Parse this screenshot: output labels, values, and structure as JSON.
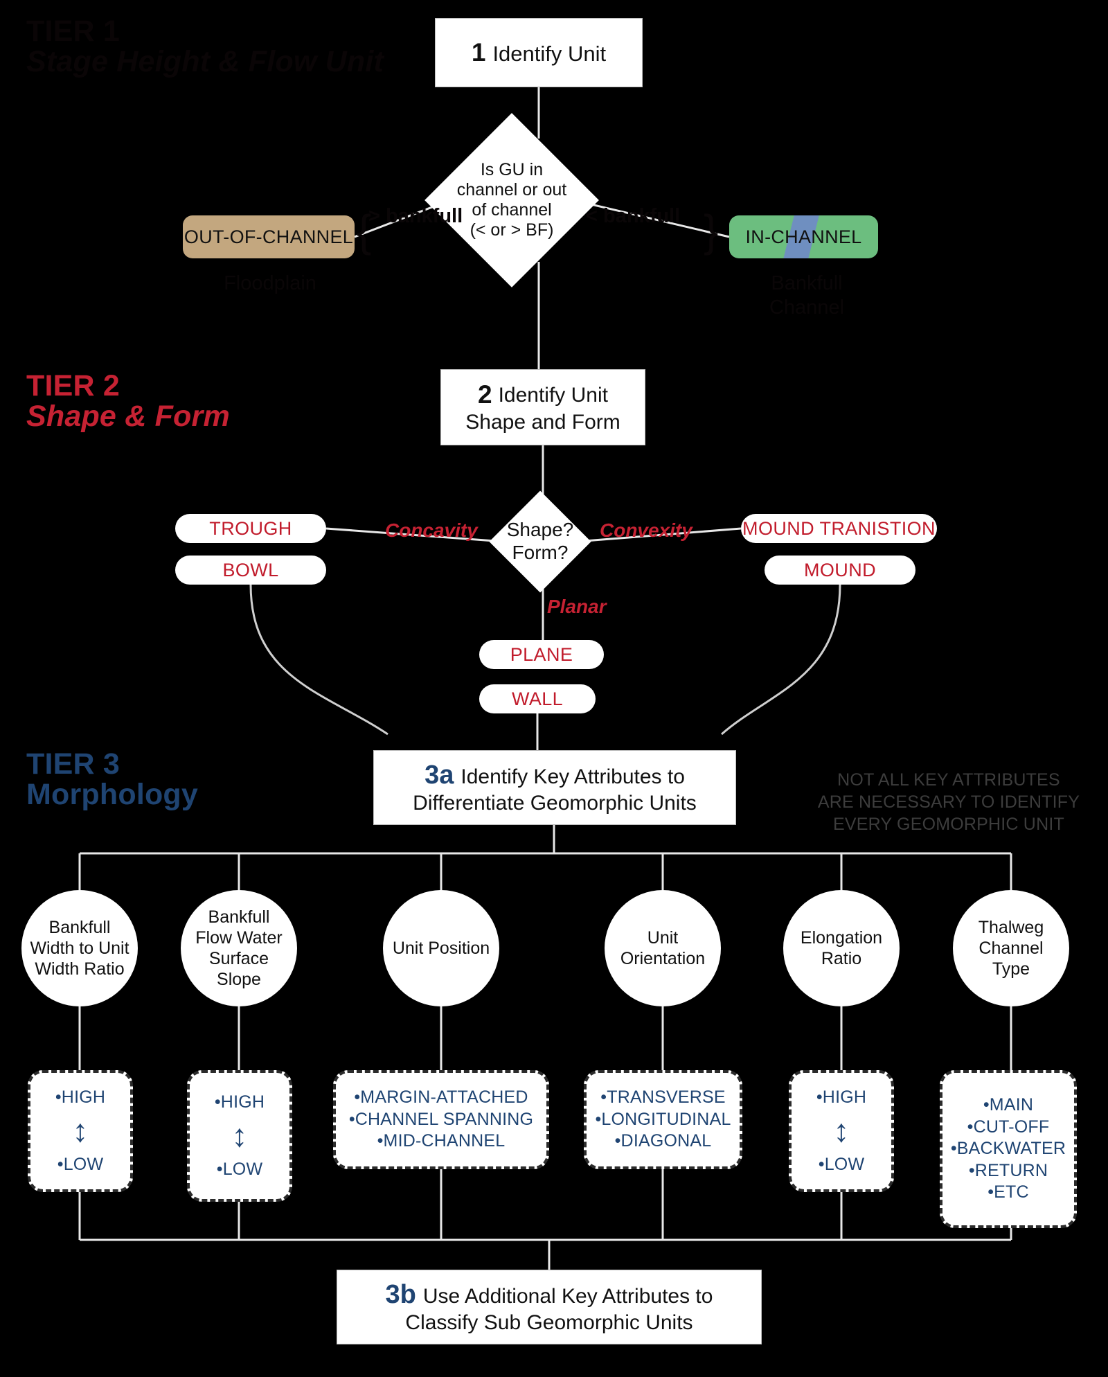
{
  "colors": {
    "red": "#c62233",
    "blue": "#1f4472",
    "tan": "#c3a77f",
    "green": "#6cbe7f",
    "water": "#6f8fc0",
    "gray_note": "#3d3d3d",
    "background": "#000000"
  },
  "tiers": [
    {
      "name": "tier-1",
      "line1": "TIER 1",
      "line2": "Stage Height & Flow Unit"
    },
    {
      "name": "tier-2",
      "line1": "TIER 2",
      "line2": "Shape & Form"
    },
    {
      "name": "tier-3",
      "line1": "TIER 3",
      "line2": "Morphology"
    }
  ],
  "steps": {
    "step1": {
      "num": "1",
      "text": "Identify Unit"
    },
    "step2": {
      "num": "2",
      "text_line1": "Identify Unit",
      "text_line2": "Shape and Form"
    },
    "step3a": {
      "num": "3a",
      "text_line1": "Identify Key Attributes to",
      "text_line2": "Differentiate Geomorphic Units"
    },
    "step3b": {
      "num": "3b",
      "text_line1": "Use Additional Key Attributes to",
      "text_line2": "Classify Sub Geomorphic Units"
    }
  },
  "decisions": {
    "channel": {
      "line1": "Is GU in",
      "line2": "channel or out",
      "line3": "of channel",
      "line4": "(< or > BF)"
    },
    "shape": {
      "line1": "Shape?",
      "line2": "Form?"
    }
  },
  "tier1_branches": {
    "left_condition": "> bankfull",
    "right_condition": "< bankfull",
    "left_chip": "OUT-OF-CHANNEL",
    "right_chip": "IN-CHANNEL",
    "left_caption": "Floodplain",
    "right_caption_line1": "Bankfull",
    "right_caption_line2": "Channel"
  },
  "tier2_words": {
    "concavity": "Concavity",
    "convexity": "Convexity",
    "planar": "Planar"
  },
  "tier2_pills": {
    "trough": "TROUGH",
    "bowl": "BOWL",
    "mound_transition": "MOUND TRANISTION",
    "mound": "MOUND",
    "plane": "PLANE",
    "wall": "WALL"
  },
  "note": {
    "line1": "NOT ALL KEY ATTRIBUTES",
    "line2": "ARE NECESSARY TO IDENTIFY",
    "line3": "EVERY GEOMORPHIC UNIT"
  },
  "attributes": [
    {
      "id": "bankfull-width-to-unit-width-ratio",
      "circle": "Bankfull Width to Unit Width Ratio",
      "type": "range",
      "options": [
        "•HIGH",
        "•LOW"
      ],
      "arrow": "↕"
    },
    {
      "id": "bankfull-flow-water-surface-slope",
      "circle": "Bankfull Flow Water Surface Slope",
      "type": "range",
      "options": [
        "•HIGH",
        "•LOW"
      ],
      "arrow": "↕"
    },
    {
      "id": "unit-position",
      "circle": "Unit Position",
      "type": "list",
      "options": [
        "•MARGIN-ATTACHED",
        "•CHANNEL SPANNING",
        "•MID-CHANNEL"
      ]
    },
    {
      "id": "unit-orientation",
      "circle": "Unit Orientation",
      "type": "list",
      "options": [
        "•TRANSVERSE",
        "•LONGITUDINAL",
        "•DIAGONAL"
      ]
    },
    {
      "id": "elongation-ratio",
      "circle": "Elongation Ratio",
      "type": "range",
      "options": [
        "•HIGH",
        "•LOW"
      ],
      "arrow": "↕"
    },
    {
      "id": "thalweg-channel-type",
      "circle": "Thalweg Channel Type",
      "type": "list",
      "options": [
        "•MAIN",
        "•CUT-OFF",
        "•BACKWATER",
        "•RETURN",
        "•ETC"
      ]
    }
  ]
}
